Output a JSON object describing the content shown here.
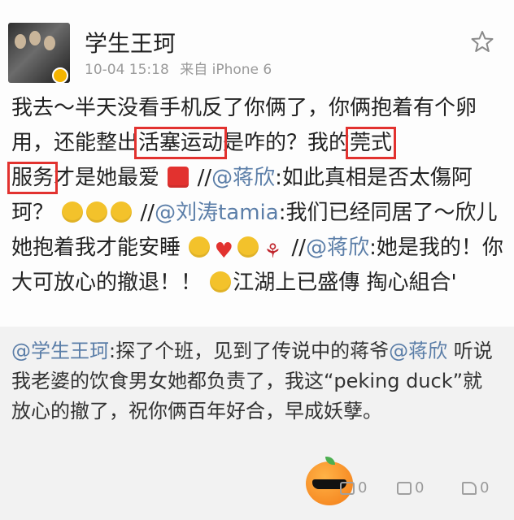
{
  "post": {
    "username": "学生王珂",
    "time": "10-04 15:18",
    "source": "来自 iPhone 6",
    "segments": {
      "s1": "我去～半天没看手机反了你俩了，你俩抱着有个卵用，还能整出",
      "hl1": "活塞运动",
      "s2": "是咋的？我的",
      "hl2a": "莞式",
      "hl2b": "服务",
      "s3": "才是她最爱",
      "s4": "//",
      "m1": "@蒋欣",
      "s5": ":如此真相是否太傷阿珂？",
      "s6": "//",
      "m2": "@刘涛tamia",
      "s7": ":我们已经同居了～欣儿她抱着我才能安睡",
      "s8": "//",
      "m3": "@蒋欣",
      "s9": ":她是我的！你大可放心的撤退！！",
      "s10": "江湖上已盛傳 掏心組合'"
    }
  },
  "repost": {
    "m1": "@学生王珂",
    "t1": ":探了个班，见到了传说中的蒋爷",
    "m2": "@蒋欣",
    "t2": " 听说我老婆的饮食男女她都负责了，我这“peking duck”就放心的撤了，祝你俩百年好合，早成妖孽。"
  },
  "toolbar": {
    "repost_count": "0",
    "comment_count": "0",
    "like_count": "0"
  },
  "icons": [
    "star-icon",
    "verified-badge-icon",
    "repost-icon",
    "comment-icon",
    "like-icon",
    "orange-sticker-icon"
  ],
  "colors": {
    "highlight": "#e2322f",
    "mention": "#5b7ea8",
    "badge": "#f5b400"
  }
}
